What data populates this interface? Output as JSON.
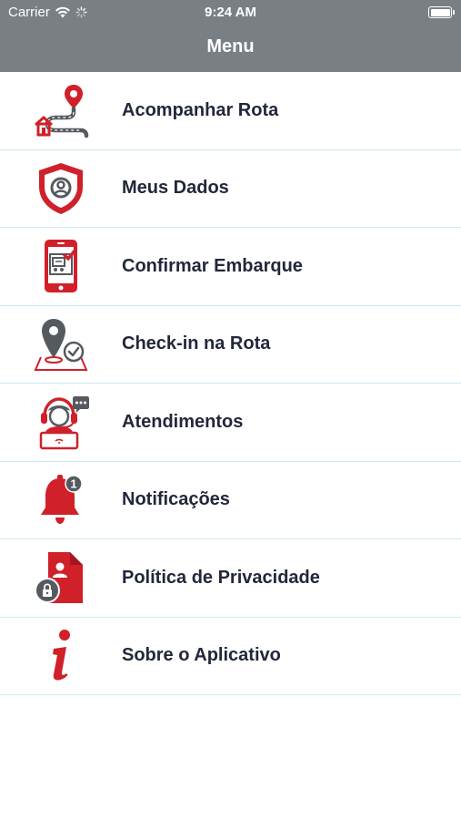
{
  "status": {
    "carrier": "Carrier",
    "time": "9:24 AM"
  },
  "nav": {
    "title": "Menu"
  },
  "colors": {
    "header_bg": "#7a7f84",
    "accent_red": "#d0202a",
    "icon_gray": "#555a60",
    "divider": "#cfe6f2",
    "text": "#22283a"
  },
  "menu": {
    "items": [
      {
        "label": "Acompanhar Rota",
        "icon": "route-map-icon"
      },
      {
        "label": "Meus Dados",
        "icon": "user-shield-icon"
      },
      {
        "label": "Confirmar Embarque",
        "icon": "phone-bus-ticket-icon"
      },
      {
        "label": "Check-in na Rota",
        "icon": "location-check-icon"
      },
      {
        "label": "Atendimentos",
        "icon": "support-agent-icon"
      },
      {
        "label": "Notificações",
        "icon": "bell-icon",
        "badge": "1"
      },
      {
        "label": "Política de Privacidade",
        "icon": "privacy-document-icon"
      },
      {
        "label": "Sobre o Aplicativo",
        "icon": "info-icon"
      }
    ]
  }
}
